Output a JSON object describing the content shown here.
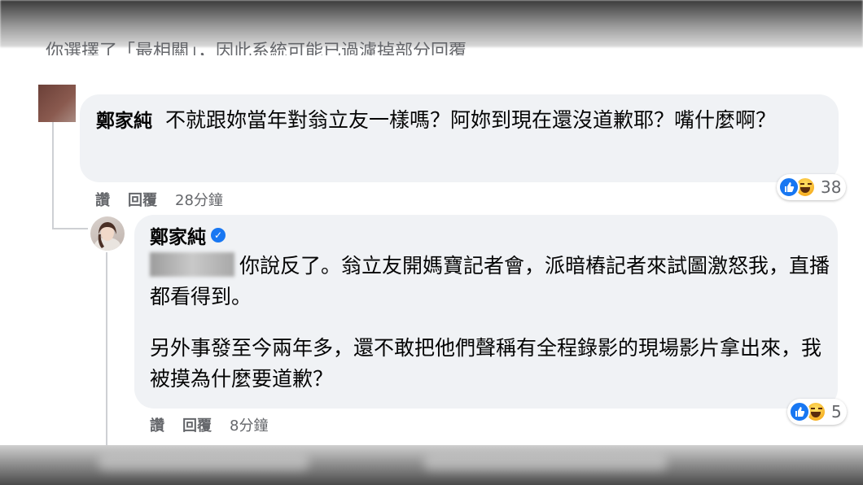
{
  "top_cutoff_text": "你選擇了「最相關」，因此系統可能已過濾掉部分回覆",
  "comment1": {
    "author": "鄭家純",
    "text": "不就跟妳當年對翁立友一樣嗎？阿妳到現在還沒道歉耶？嘴什麼啊？",
    "reaction_count": "38",
    "actions": {
      "like": "讚",
      "reply": "回覆",
      "time": "28分鐘"
    }
  },
  "comment2": {
    "author": "鄭家純",
    "verified": true,
    "paragraph1": "你說反了。翁立友開媽寶記者會，派暗樁記者來試圖激怒我，直播都看得到。",
    "paragraph2": "另外事發至今兩年多，還不敢把他們聲稱有全程錄影的現場影片拿出來，我被摸為什麼要道歉？",
    "reaction_count": "5",
    "actions": {
      "like": "讚",
      "reply": "回覆",
      "time": "8分鐘"
    }
  },
  "icons": {
    "like": "like-reaction-icon",
    "haha": "haha-reaction-icon",
    "verified": "verified-badge-icon"
  },
  "colors": {
    "bubble": "#f0f2f5",
    "meta_text": "#65676b",
    "like_blue": "#1877f2"
  }
}
